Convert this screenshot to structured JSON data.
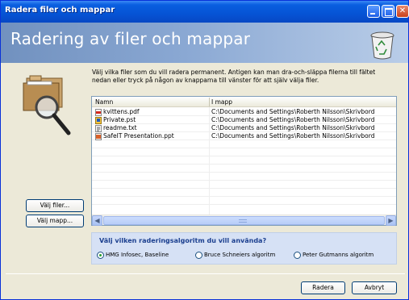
{
  "window": {
    "title": "Radera filer och mappar"
  },
  "header": {
    "title": "Radering av filer och mappar"
  },
  "description": "Välj vilka filer som du vill radera permanent. Antigen kan man dra-och-släppa filerna till fältet nedan eller tryck på någon av knapparna till vänster för att själv välja filer.",
  "list": {
    "columns": [
      "Namn",
      "I mapp"
    ],
    "rows": [
      {
        "name": "kvittens.pdf",
        "folder": "C:\\Documents and Settings\\Roberth Nilsson\\Skrivbord",
        "icon": "pdf-file-icon"
      },
      {
        "name": "Private.pst",
        "folder": "C:\\Documents and Settings\\Roberth Nilsson\\Skrivbord",
        "icon": "pst-file-icon"
      },
      {
        "name": "readme.txt",
        "folder": "C:\\Documents and Settings\\Roberth Nilsson\\Skrivbord",
        "icon": "txt-file-icon"
      },
      {
        "name": "SafeIT Presentation.ppt",
        "folder": "C:\\Documents and Settings\\Roberth Nilsson\\Skrivbord",
        "icon": "ppt-file-icon"
      }
    ]
  },
  "buttons": {
    "choose_files": "Välj filer...",
    "choose_folder": "Välj mapp...",
    "delete": "Radera",
    "cancel": "Avbryt"
  },
  "algorithm": {
    "question": "Välj vilken raderingsalgoritm du vill använda?",
    "options": [
      "HMG Infosec, Baseline",
      "Bruce Schneiers algoritm",
      "Peter Gutmanns algoritm"
    ],
    "selected": "HMG Infosec, Baseline"
  },
  "colors": {
    "titlebar": "#0553d5",
    "header": "#8aa8d3",
    "algo_panel": "#d6e1f5",
    "question_text": "#1b3f8f"
  }
}
